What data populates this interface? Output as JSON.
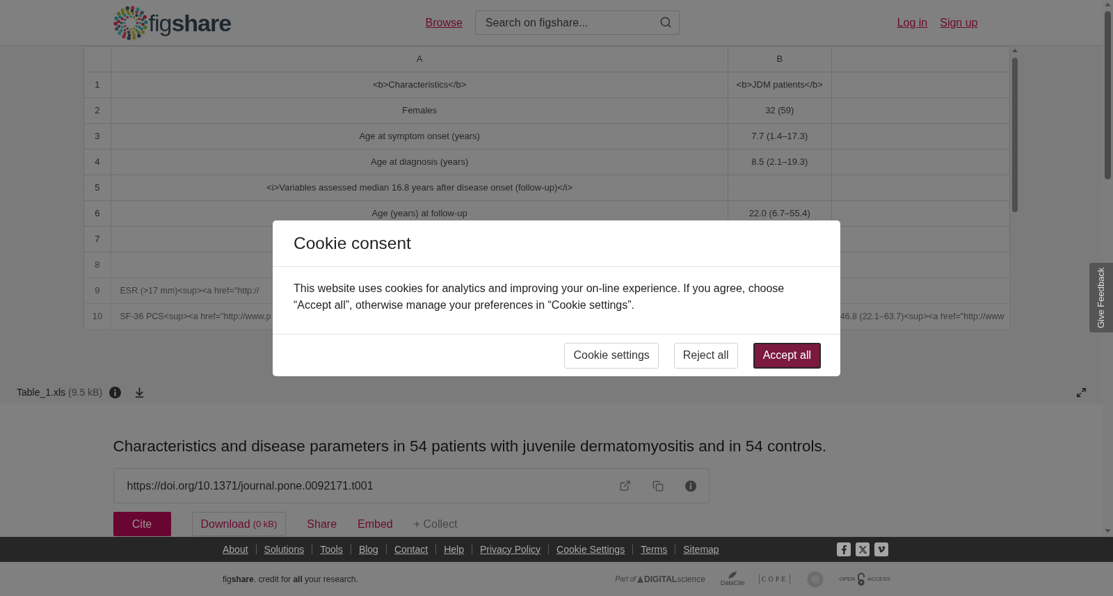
{
  "header": {
    "logo": {
      "text": "fig**share**"
    },
    "nav": [
      {
        "label": "Browse"
      }
    ],
    "search": {
      "placeholder": "Search on figshare..."
    },
    "account_links": [
      {
        "label": "Log in"
      },
      {
        "label": "Sign up"
      }
    ]
  },
  "preview": {
    "columns": [
      "A",
      "B"
    ],
    "rows": [
      {
        "number": "1",
        "faded": false,
        "cells": [
          "<b>Characteristics</b>",
          "<b>JDM patients</b>"
        ]
      },
      {
        "number": "2",
        "faded": false,
        "cells": [
          "Females",
          "32 (59)"
        ]
      },
      {
        "number": "3",
        "faded": false,
        "cells": [
          "Age at symptom onset (years)",
          "7.7 (1.4–17.3)"
        ]
      },
      {
        "number": "4",
        "faded": false,
        "cells": [
          "Age at diagnosis (years)",
          "8.5 (2.1–19.3)"
        ]
      },
      {
        "number": "5",
        "faded": false,
        "cells": [
          "<i>Variables assessed median 16.8 years after disease onset (follow-up)</i>"
        ]
      },
      {
        "number": "6",
        "faded": false,
        "cells": [
          "Age (years) at follow-up",
          "22.0 (6.7–55.4)"
        ]
      },
      {
        "number": "7",
        "faded": false
      },
      {
        "number": "8",
        "faded": true
      },
      {
        "number": "9",
        "faded": true,
        "cells": [
          "ESR (>17 mm)<sup><a href=\"http://"
        ]
      },
      {
        "number": "10",
        "faded": true,
        "cells": [
          "SF-36 PCS<sup><a href=\"http://www.p",
          null,
          "46.8 (22.1–63.7)<sup><a href=\"http://www"
        ]
      }
    ],
    "file": {
      "name": "Table_1.xls",
      "size": "(9.5 kB)"
    }
  },
  "item": {
    "title": "Characteristics and disease parameters in 54 patients with juvenile dermatomyositis and in 54 controls.",
    "doi": "https://doi.org/10.1371/journal.pone.0092171.t001",
    "actions": [
      {
        "kind": "primary",
        "label": "Cite"
      },
      {
        "kind": "outline",
        "label": "Download",
        "note": "(0 kB)"
      },
      {
        "kind": "link",
        "label": "Share"
      },
      {
        "kind": "link",
        "label": "Embed"
      },
      {
        "kind": "muted",
        "label": "+ Collect"
      }
    ]
  },
  "feedback_tab": {
    "label": "Give Feedback"
  },
  "footer": {
    "links": [
      "About",
      "Solutions",
      "Tools",
      "Blog",
      "Contact",
      "Help",
      "Privacy Policy",
      "Cookie Settings",
      "Terms",
      "Sitemap"
    ],
    "tagline": "fig**share**. credit for **all** your research.",
    "partners": [
      {
        "kind": "digital-science",
        "prefix": "Part of",
        "label": "**DIGITAL**science"
      },
      {
        "kind": "datacite",
        "label": "DataCite"
      },
      {
        "kind": "cope",
        "label": "COPE"
      },
      {
        "kind": "seal"
      },
      {
        "kind": "open-access",
        "prefix": "OPEN",
        "label": "ACCESS"
      }
    ]
  },
  "cookie_dialog": {
    "title": "Cookie consent",
    "body": "This website uses cookies for analytics and improving your on-line experience. If you agree, choose “Accept all”, otherwise manage your preferences in “Cookie settings”.",
    "buttons": [
      {
        "label": "Cookie settings",
        "kind": "secondary",
        "focused": false
      },
      {
        "label": "Reject all",
        "kind": "secondary",
        "focused": false
      },
      {
        "label": "Accept all",
        "kind": "primary",
        "focused": true
      }
    ]
  }
}
